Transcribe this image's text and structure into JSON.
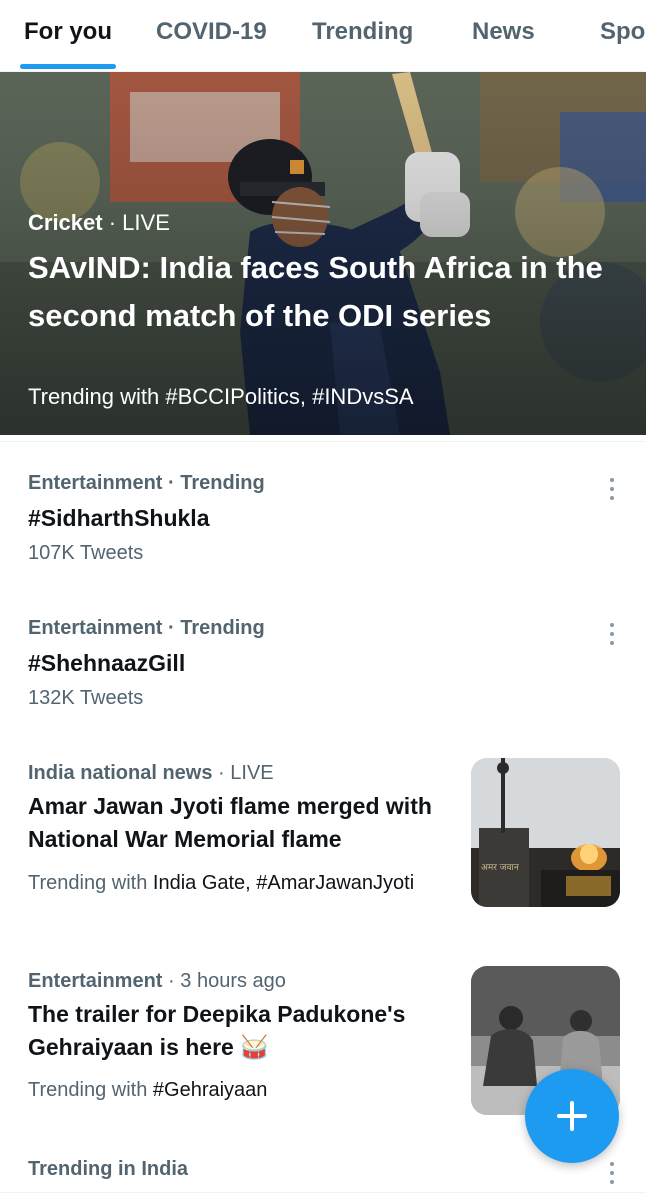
{
  "tabs": [
    {
      "label": "For you"
    },
    {
      "label": "COVID-19"
    },
    {
      "label": "Trending"
    },
    {
      "label": "News"
    },
    {
      "label": "Spo"
    }
  ],
  "hero": {
    "category": "Cricket",
    "separator": "·",
    "status": "LIVE",
    "title": "SAvIND: India faces South Africa in the second match of the ODI series",
    "trending_prefix": "Trending with",
    "trending_tags": "#BCCIPolitics, #INDvsSA"
  },
  "trends": [
    {
      "category": "Entertainment",
      "separator": "·",
      "status": "Trending",
      "topic": "#SidharthShukla",
      "count": "107K Tweets"
    },
    {
      "category": "Entertainment",
      "separator": "·",
      "status": "Trending",
      "topic": "#ShehnaazGill",
      "count": "132K Tweets"
    }
  ],
  "news": [
    {
      "category": "India national news",
      "separator": "·",
      "status": "LIVE",
      "title": "Amar Jawan Jyoti flame merged with National War Memorial flame",
      "trending_prefix": "Trending with",
      "trending_tags": "India Gate, #AmarJawanJyoti",
      "thumb_text": "अमर जवान"
    },
    {
      "category": "Entertainment",
      "separator": "·",
      "status": "3 hours ago",
      "title": "The trailer for Deepika Padukone's Gehraiyaan is here 🥁",
      "trending_prefix": "Trending with",
      "trending_tags": "#Gehraiyaan"
    }
  ],
  "bottom_section": {
    "title": "Trending in India"
  },
  "colors": {
    "accent": "#1d9bf0",
    "text": "#0f1419",
    "secondary": "#536471"
  },
  "icons": {
    "more": "more-vertical-icon",
    "compose": "plus-icon"
  }
}
